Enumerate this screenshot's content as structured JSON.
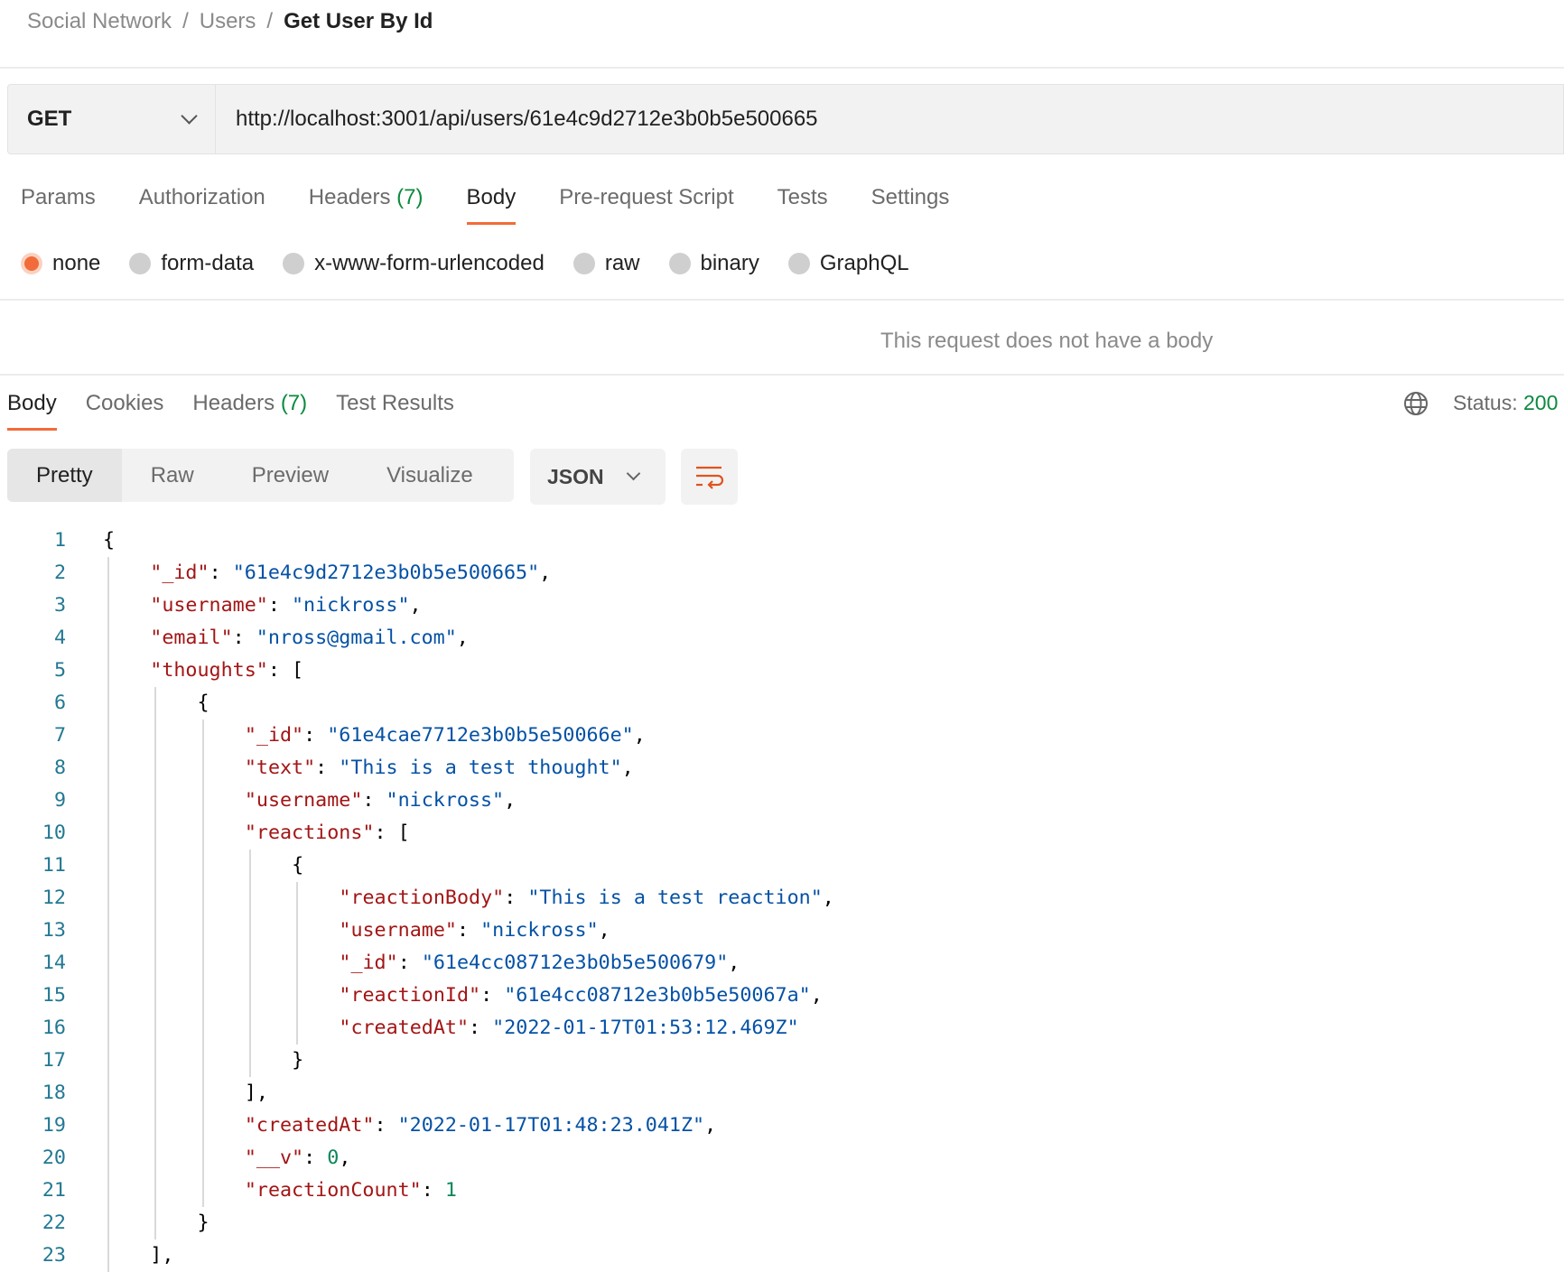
{
  "breadcrumb": [
    "Social Network",
    "Users",
    "Get User By Id"
  ],
  "breadcrumb_separator": "/",
  "request": {
    "method": "GET",
    "url": "http://localhost:3001/api/users/61e4c9d2712e3b0b5e500665"
  },
  "request_tabs": [
    {
      "label": "Params"
    },
    {
      "label": "Authorization"
    },
    {
      "label": "Headers",
      "count": "(7)"
    },
    {
      "label": "Body",
      "active": true
    },
    {
      "label": "Pre-request Script"
    },
    {
      "label": "Tests"
    },
    {
      "label": "Settings"
    }
  ],
  "body_types": [
    {
      "label": "none",
      "selected": true
    },
    {
      "label": "form-data"
    },
    {
      "label": "x-www-form-urlencoded"
    },
    {
      "label": "raw"
    },
    {
      "label": "binary"
    },
    {
      "label": "GraphQL"
    }
  ],
  "no_body_message": "This request does not have a body",
  "response_tabs": [
    {
      "label": "Body",
      "active": true
    },
    {
      "label": "Cookies"
    },
    {
      "label": "Headers",
      "count": "(7)"
    },
    {
      "label": "Test Results"
    }
  ],
  "status": {
    "label": "Status:",
    "value": "200"
  },
  "view_modes": [
    {
      "label": "Pretty",
      "active": true
    },
    {
      "label": "Raw"
    },
    {
      "label": "Preview"
    },
    {
      "label": "Visualize"
    }
  ],
  "format": "JSON",
  "colors": {
    "accent": "#f26b3a",
    "key": "#a31515",
    "string": "#0451a5",
    "number": "#098658",
    "line_number": "#237893",
    "status_ok": "#0c8a3e"
  },
  "icons": {
    "method_dropdown": "chevron-down-icon",
    "globe": "globe-icon",
    "wrap": "word-wrap-icon"
  },
  "code_lines": [
    {
      "i": 0,
      "t": [
        [
          "p",
          "{"
        ]
      ]
    },
    {
      "i": 1,
      "t": [
        [
          "k",
          "\"_id\""
        ],
        [
          "p",
          ": "
        ],
        [
          "s",
          "\"61e4c9d2712e3b0b5e500665\""
        ],
        [
          "p",
          ","
        ]
      ]
    },
    {
      "i": 1,
      "t": [
        [
          "k",
          "\"username\""
        ],
        [
          "p",
          ": "
        ],
        [
          "s",
          "\"nickross\""
        ],
        [
          "p",
          ","
        ]
      ]
    },
    {
      "i": 1,
      "t": [
        [
          "k",
          "\"email\""
        ],
        [
          "p",
          ": "
        ],
        [
          "s",
          "\"nross@gmail.com\""
        ],
        [
          "p",
          ","
        ]
      ]
    },
    {
      "i": 1,
      "t": [
        [
          "k",
          "\"thoughts\""
        ],
        [
          "p",
          ": ["
        ]
      ]
    },
    {
      "i": 2,
      "t": [
        [
          "p",
          "{"
        ]
      ]
    },
    {
      "i": 3,
      "t": [
        [
          "k",
          "\"_id\""
        ],
        [
          "p",
          ": "
        ],
        [
          "s",
          "\"61e4cae7712e3b0b5e50066e\""
        ],
        [
          "p",
          ","
        ]
      ]
    },
    {
      "i": 3,
      "t": [
        [
          "k",
          "\"text\""
        ],
        [
          "p",
          ": "
        ],
        [
          "s",
          "\"This is a test thought\""
        ],
        [
          "p",
          ","
        ]
      ]
    },
    {
      "i": 3,
      "t": [
        [
          "k",
          "\"username\""
        ],
        [
          "p",
          ": "
        ],
        [
          "s",
          "\"nickross\""
        ],
        [
          "p",
          ","
        ]
      ]
    },
    {
      "i": 3,
      "t": [
        [
          "k",
          "\"reactions\""
        ],
        [
          "p",
          ": ["
        ]
      ]
    },
    {
      "i": 4,
      "t": [
        [
          "p",
          "{"
        ]
      ]
    },
    {
      "i": 5,
      "t": [
        [
          "k",
          "\"reactionBody\""
        ],
        [
          "p",
          ": "
        ],
        [
          "s",
          "\"This is a test reaction\""
        ],
        [
          "p",
          ","
        ]
      ]
    },
    {
      "i": 5,
      "t": [
        [
          "k",
          "\"username\""
        ],
        [
          "p",
          ": "
        ],
        [
          "s",
          "\"nickross\""
        ],
        [
          "p",
          ","
        ]
      ]
    },
    {
      "i": 5,
      "t": [
        [
          "k",
          "\"_id\""
        ],
        [
          "p",
          ": "
        ],
        [
          "s",
          "\"61e4cc08712e3b0b5e500679\""
        ],
        [
          "p",
          ","
        ]
      ]
    },
    {
      "i": 5,
      "t": [
        [
          "k",
          "\"reactionId\""
        ],
        [
          "p",
          ": "
        ],
        [
          "s",
          "\"61e4cc08712e3b0b5e50067a\""
        ],
        [
          "p",
          ","
        ]
      ]
    },
    {
      "i": 5,
      "t": [
        [
          "k",
          "\"createdAt\""
        ],
        [
          "p",
          ": "
        ],
        [
          "s",
          "\"2022-01-17T01:53:12.469Z\""
        ]
      ]
    },
    {
      "i": 4,
      "t": [
        [
          "p",
          "}"
        ]
      ]
    },
    {
      "i": 3,
      "t": [
        [
          "p",
          "],"
        ]
      ]
    },
    {
      "i": 3,
      "t": [
        [
          "k",
          "\"createdAt\""
        ],
        [
          "p",
          ": "
        ],
        [
          "s",
          "\"2022-01-17T01:48:23.041Z\""
        ],
        [
          "p",
          ","
        ]
      ]
    },
    {
      "i": 3,
      "t": [
        [
          "k",
          "\"__v\""
        ],
        [
          "p",
          ": "
        ],
        [
          "n",
          "0"
        ],
        [
          "p",
          ","
        ]
      ]
    },
    {
      "i": 3,
      "t": [
        [
          "k",
          "\"reactionCount\""
        ],
        [
          "p",
          ": "
        ],
        [
          "n",
          "1"
        ]
      ]
    },
    {
      "i": 2,
      "t": [
        [
          "p",
          "}"
        ]
      ]
    },
    {
      "i": 1,
      "t": [
        [
          "p",
          "],"
        ]
      ]
    }
  ]
}
